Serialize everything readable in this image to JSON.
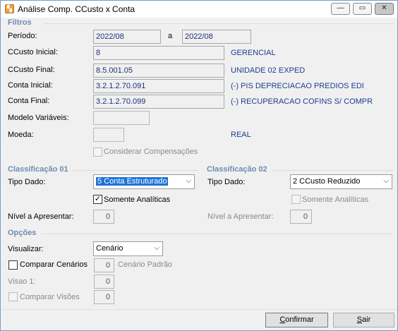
{
  "window": {
    "title": "Análise Comp. CCusto x Conta",
    "minimize_icon": "minimize-icon",
    "maximize_icon": "maximize-icon",
    "close_icon": "close-icon"
  },
  "filtros": {
    "section_label": "Filtros",
    "periodo_label": "Período:",
    "periodo_de": "2022/08",
    "a_label": "a",
    "periodo_ate": "2022/08",
    "ccusto_inicial_label": "CCusto Inicial:",
    "ccusto_inicial_value": "8",
    "ccusto_inicial_desc": "GERENCIAL",
    "ccusto_final_label": "CCusto Final:",
    "ccusto_final_value": "8.5.001.05",
    "ccusto_final_desc": "UNIDADE 02 EXPED",
    "conta_inicial_label": "Conta Inicial:",
    "conta_inicial_value": "3.2.1.2.70.091",
    "conta_inicial_desc": "(-) PIS DEPRECIACAO PREDIOS EDI",
    "conta_final_label": "Conta Final:",
    "conta_final_value": "3.2.1.2.70.099",
    "conta_final_desc": "(-) RECUPERACAO COFINS S/ COMPR",
    "modelo_label": "Modelo Variáveis:",
    "modelo_value": "",
    "moeda_label": "Moeda:",
    "moeda_value": "",
    "moeda_desc": "REAL",
    "considerar_label": "Considerar Compensações",
    "considerar_checked": false
  },
  "classificacao01": {
    "section_label": "Classificação 01",
    "tipo_label": "Tipo Dado:",
    "tipo_value": "5 Conta Estruturado",
    "somente_label": "Somente Analíticas",
    "somente_checked": true,
    "nivel_label": "Nível a Apresentar:",
    "nivel_value": "0"
  },
  "classificacao02": {
    "section_label": "Classificação 02",
    "tipo_label": "Tipo Dado:",
    "tipo_value": "2 CCusto Reduzido",
    "somente_label": "Somente Analíticas",
    "somente_checked": false,
    "nivel_label": "Nível a Apresentar:",
    "nivel_value": "0"
  },
  "opcoes": {
    "section_label": "Opções",
    "visualizar_label": "Visualizar:",
    "visualizar_value": "Cenário",
    "comparar_cenarios_label": "Comparar Cenários",
    "comparar_cenarios_value": "0",
    "cenario_padrao_label": "Cenário Padrão",
    "visao1_label": "Visao 1:",
    "visao1_value": "0",
    "comparar_visoes_label": "Comparar Visões",
    "comparar_visoes_value": "0"
  },
  "buttons": {
    "confirmar_first": "C",
    "confirmar_rest": "onfirmar",
    "sair_first": "S",
    "sair_rest": "air"
  },
  "glyphs": {
    "check": "✓",
    "dropdown": "⌵"
  }
}
